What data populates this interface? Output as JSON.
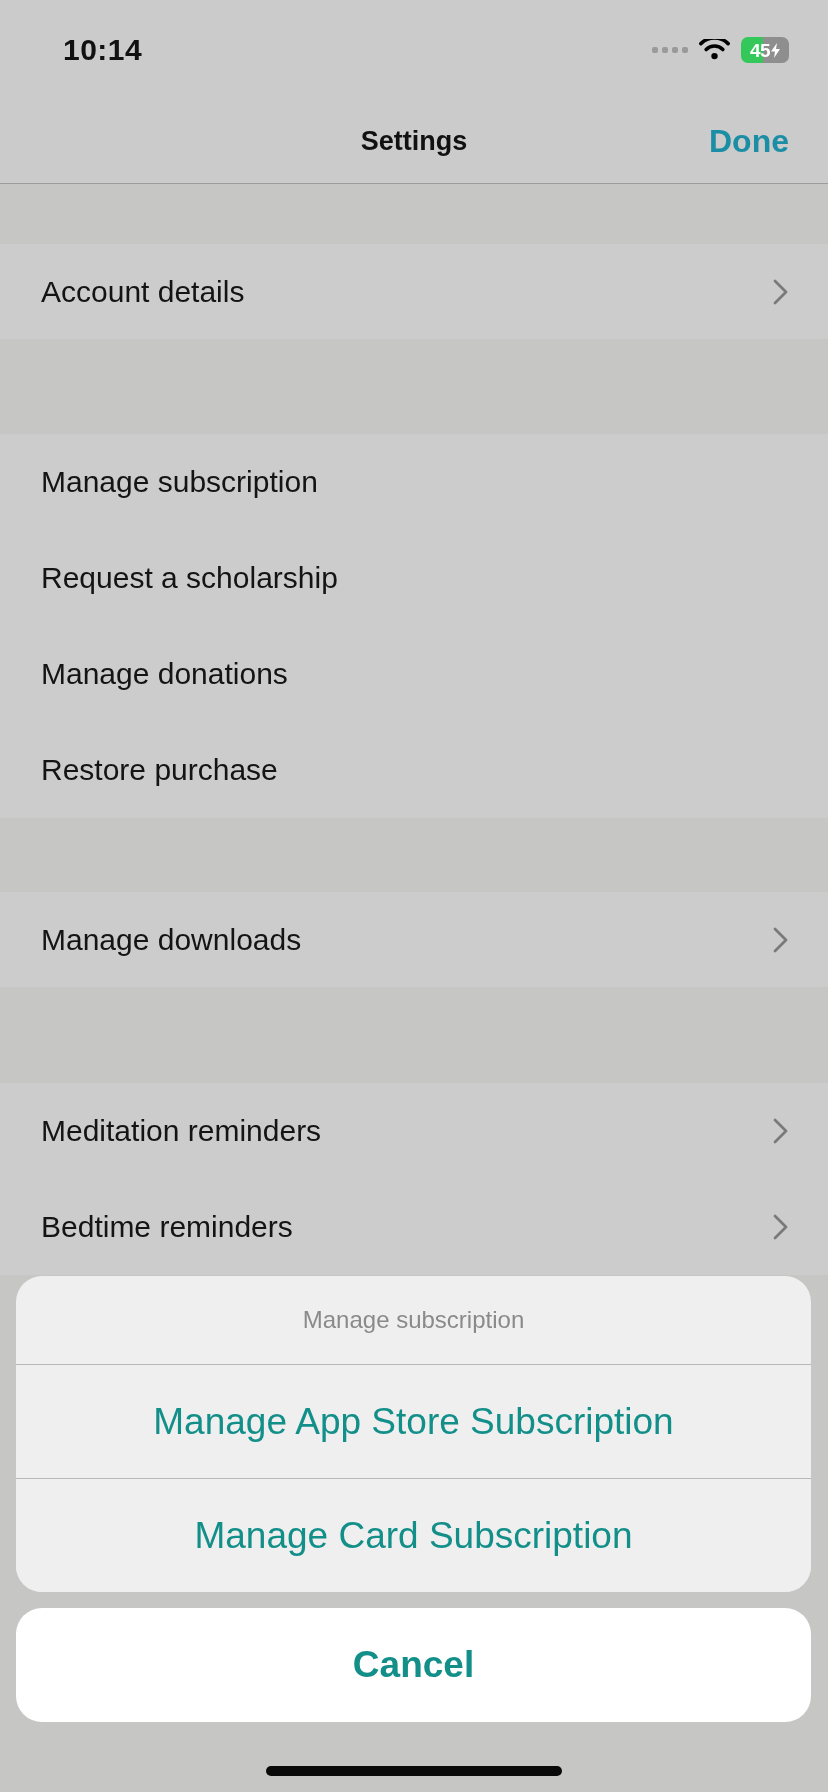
{
  "status_bar": {
    "time": "10:14",
    "battery": "45"
  },
  "nav_bar": {
    "title": "Settings",
    "done": "Done"
  },
  "sections": [
    {
      "rows": [
        {
          "label": "Account details",
          "chevron": true
        }
      ]
    },
    {
      "rows": [
        {
          "label": "Manage subscription",
          "chevron": false
        },
        {
          "label": "Request a scholarship",
          "chevron": false
        },
        {
          "label": "Manage donations",
          "chevron": false
        },
        {
          "label": "Restore purchase",
          "chevron": false
        }
      ]
    },
    {
      "rows": [
        {
          "label": "Manage downloads",
          "chevron": true
        }
      ]
    },
    {
      "rows": [
        {
          "label": "Meditation reminders",
          "chevron": true
        },
        {
          "label": "Bedtime reminders",
          "chevron": true
        }
      ]
    }
  ],
  "action_sheet": {
    "title": "Manage subscription",
    "actions": [
      "Manage App Store Subscription",
      "Manage Card Subscription"
    ],
    "cancel": "Cancel"
  }
}
